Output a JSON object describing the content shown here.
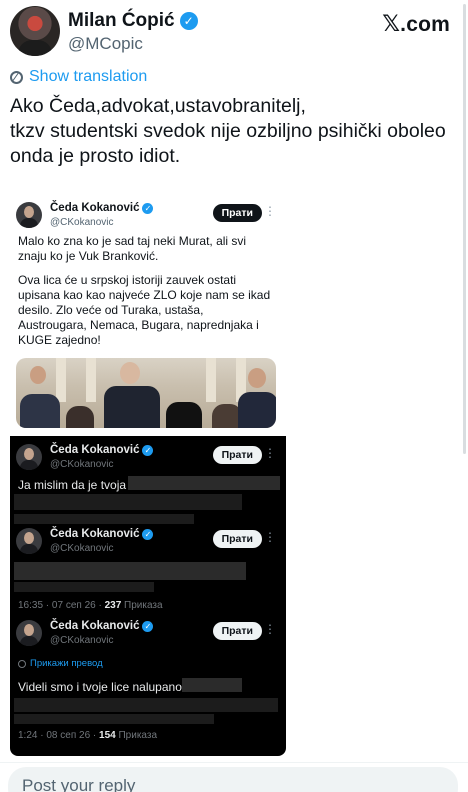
{
  "author": {
    "name": "Milan Ćopić",
    "handle": "@MCopic"
  },
  "brand": {
    "glyph": "𝕏",
    "suffix": ".com"
  },
  "translation": {
    "label": "Show translation"
  },
  "tweet": {
    "lines": [
      "Ako Čeda,advokat,ustavobranitelj,",
      "tkzv studentski svedok nije ozbiljno psihički oboleo",
      "onda je prosto idiot."
    ]
  },
  "embedded": {
    "main_post": {
      "name": "Čeda Kokanović",
      "handle": "@CKokanovic",
      "follow_label": "Прати",
      "text_lines": [
        "Malo ko zna ko je sad taj neki Murat, ali svi",
        "znaju ko je Vuk Branković.",
        "",
        "Ova lica će u srpskoj istoriji zauvek ostati",
        "upisana kao kao najveće ZLO koje nam se ikad",
        "desilo. Zlo veće od Turaka, ustaša,",
        "Austrougara, Nemaca, Bugara, naprednjaka i",
        "KUGE zajedno!"
      ]
    },
    "replies": [
      {
        "name": "Čeda Kokanović",
        "handle": "@CKokanovic",
        "follow_label": "Прати",
        "text": "Ja mislim da je tvoja"
      },
      {
        "name": "Čeda Kokanović",
        "handle": "@CKokanovic",
        "follow_label": "Прати",
        "meta_time": "16:35 · 07 сеп 26 · ",
        "meta_views": "237",
        "meta_views_label": " Приказа"
      },
      {
        "name": "Čeda Kokanović",
        "handle": "@CKokanovic",
        "follow_label": "Прати",
        "translate_label": "Прикажи превод",
        "text": "Videli smo i tvoje lice nalupano",
        "meta_time": "1:24 · 08 сеп 26 · ",
        "meta_views": "154",
        "meta_views_label": " Приказа"
      }
    ]
  },
  "reply": {
    "placeholder": "Post your reply"
  },
  "colors": {
    "accent": "#1d9bf0",
    "text": "#0f1419",
    "muted": "#536471"
  }
}
